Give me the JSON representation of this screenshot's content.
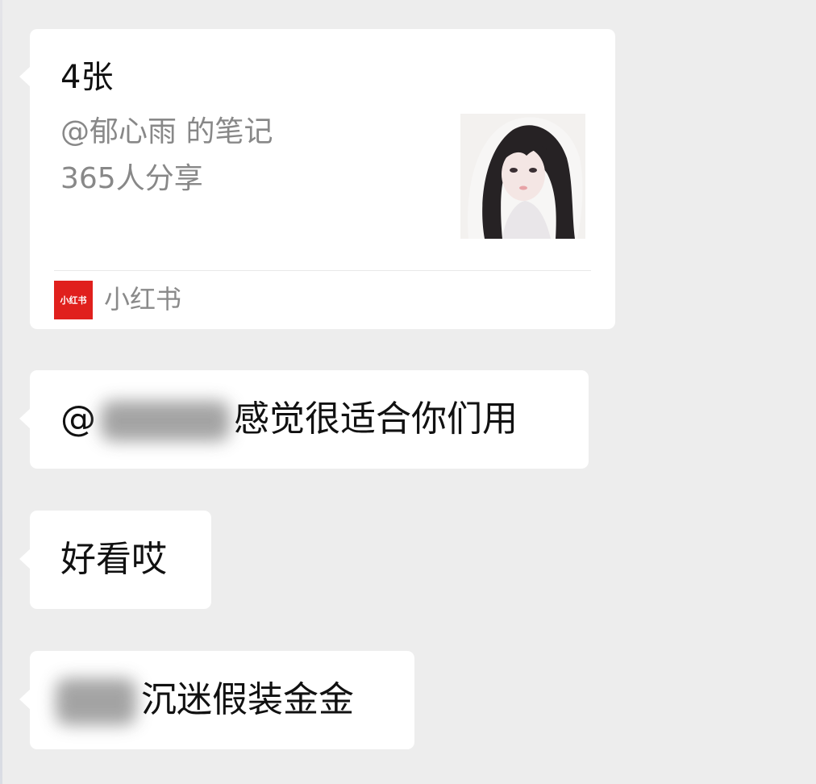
{
  "chat": {
    "card": {
      "title": "4张",
      "author": "@郁心雨 的笔记",
      "shares": "365人分享",
      "source_logo_text": "小红书",
      "source_name": "小红书"
    },
    "messages": [
      {
        "prefix": "@",
        "text": "感觉很适合你们用"
      },
      {
        "text": "好看哎"
      },
      {
        "text": "沉迷假装金金"
      }
    ]
  }
}
